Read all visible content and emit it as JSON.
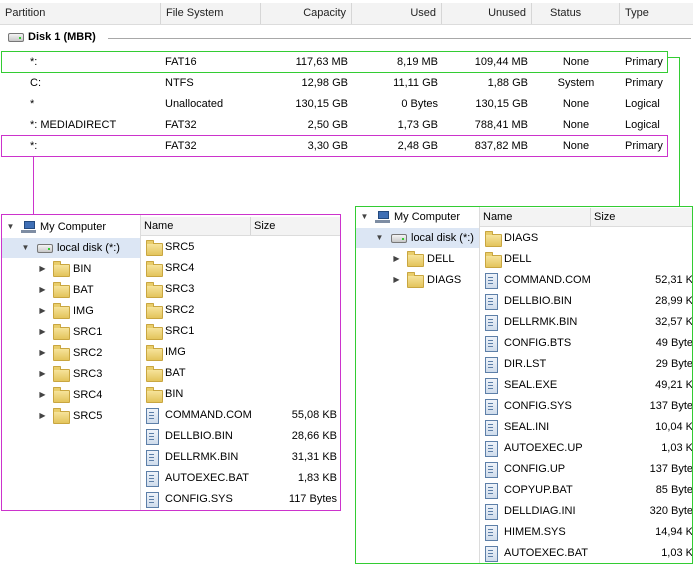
{
  "partition_table": {
    "columns": [
      "Partition",
      "File System",
      "Capacity",
      "Used",
      "Unused",
      "Status",
      "Type"
    ],
    "disk_label": "Disk 1 (MBR)",
    "rows": [
      {
        "partition": "*:",
        "fs": "FAT16",
        "capacity": "117,63 MB",
        "used": "8,19 MB",
        "unused": "109,44 MB",
        "status": "None",
        "type": "Primary"
      },
      {
        "partition": "C:",
        "fs": "NTFS",
        "capacity": "12,98 GB",
        "used": "11,11 GB",
        "unused": "1,88 GB",
        "status": "System",
        "type": "Primary"
      },
      {
        "partition": "*",
        "fs": "Unallocated",
        "capacity": "130,15 GB",
        "used": "0 Bytes",
        "unused": "130,15 GB",
        "status": "None",
        "type": "Logical"
      },
      {
        "partition": "*: MEDIADIRECT",
        "fs": "FAT32",
        "capacity": "2,50 GB",
        "used": "1,73 GB",
        "unused": "788,41 MB",
        "status": "None",
        "type": "Logical"
      },
      {
        "partition": "*:",
        "fs": "FAT32",
        "capacity": "3,30 GB",
        "used": "2,48 GB",
        "unused": "837,82 MB",
        "status": "None",
        "type": "Primary"
      }
    ]
  },
  "colors": {
    "highlight_green": "#33cc33",
    "highlight_magenta": "#cc33cc",
    "selection": "#dce6f4"
  },
  "left_panel": {
    "tree_root": "My Computer",
    "tree_drive": "local disk (*:)",
    "tree_folders": [
      "BIN",
      "BAT",
      "IMG",
      "SRC1",
      "SRC2",
      "SRC3",
      "SRC4",
      "SRC5"
    ],
    "list_columns": [
      "Name",
      "Size"
    ],
    "list_items": [
      {
        "name": "SRC5",
        "size": "",
        "kind": "folder"
      },
      {
        "name": "SRC4",
        "size": "",
        "kind": "folder"
      },
      {
        "name": "SRC3",
        "size": "",
        "kind": "folder"
      },
      {
        "name": "SRC2",
        "size": "",
        "kind": "folder"
      },
      {
        "name": "SRC1",
        "size": "",
        "kind": "folder"
      },
      {
        "name": "IMG",
        "size": "",
        "kind": "folder"
      },
      {
        "name": "BAT",
        "size": "",
        "kind": "folder"
      },
      {
        "name": "BIN",
        "size": "",
        "kind": "folder"
      },
      {
        "name": "COMMAND.COM",
        "size": "55,08 KB",
        "kind": "file"
      },
      {
        "name": "DELLBIO.BIN",
        "size": "28,66 KB",
        "kind": "file"
      },
      {
        "name": "DELLRMK.BIN",
        "size": "31,31 KB",
        "kind": "file"
      },
      {
        "name": "AUTOEXEC.BAT",
        "size": "1,83 KB",
        "kind": "file"
      },
      {
        "name": "CONFIG.SYS",
        "size": "117 Bytes",
        "kind": "file"
      }
    ]
  },
  "right_panel": {
    "tree_root": "My Computer",
    "tree_drive": "local disk (*:)",
    "tree_folders": [
      "DELL",
      "DIAGS"
    ],
    "list_columns": [
      "Name",
      "Size"
    ],
    "list_items": [
      {
        "name": "DIAGS",
        "size": "",
        "kind": "folder"
      },
      {
        "name": "DELL",
        "size": "",
        "kind": "folder"
      },
      {
        "name": "COMMAND.COM",
        "size": "52,31 K",
        "kind": "file"
      },
      {
        "name": "DELLBIO.BIN",
        "size": "28,99 K",
        "kind": "file"
      },
      {
        "name": "DELLRMK.BIN",
        "size": "32,57 K",
        "kind": "file"
      },
      {
        "name": "CONFIG.BTS",
        "size": "49 Byte",
        "kind": "file"
      },
      {
        "name": "DIR.LST",
        "size": "29 Byte",
        "kind": "file"
      },
      {
        "name": "SEAL.EXE",
        "size": "49,21 K",
        "kind": "file"
      },
      {
        "name": "CONFIG.SYS",
        "size": "137 Byte",
        "kind": "file"
      },
      {
        "name": "SEAL.INI",
        "size": "10,04 K",
        "kind": "file"
      },
      {
        "name": "AUTOEXEC.UP",
        "size": "1,03 K",
        "kind": "file"
      },
      {
        "name": "CONFIG.UP",
        "size": "137 Byte",
        "kind": "file"
      },
      {
        "name": "COPYUP.BAT",
        "size": "85 Byte",
        "kind": "file"
      },
      {
        "name": "DELLDIAG.INI",
        "size": "320 Byte",
        "kind": "file"
      },
      {
        "name": "HIMEM.SYS",
        "size": "14,94 K",
        "kind": "file"
      },
      {
        "name": "AUTOEXEC.BAT",
        "size": "1,03 K",
        "kind": "file"
      }
    ]
  }
}
